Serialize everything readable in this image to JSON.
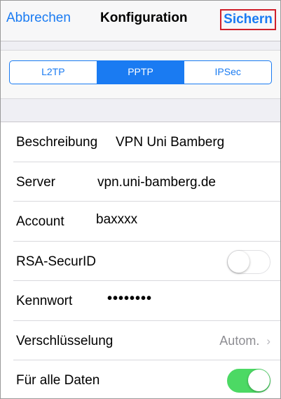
{
  "navbar": {
    "cancel_label": "Abbrechen",
    "title": "Konfiguration",
    "save_label": "Sichern"
  },
  "segments": [
    {
      "label": "L2TP",
      "active": false
    },
    {
      "label": "PPTP",
      "active": true
    },
    {
      "label": "IPSec",
      "active": false
    }
  ],
  "form": {
    "description": {
      "label": "Beschreibung",
      "value": "VPN Uni Bamberg"
    },
    "server": {
      "label": "Server",
      "value": "vpn.uni-bamberg.de"
    },
    "account": {
      "label": "Account",
      "value": "baxxxx"
    },
    "rsa": {
      "label": "RSA-SecurID",
      "toggle": "off"
    },
    "password": {
      "label": "Kennwort",
      "value": "••••••••"
    },
    "encryption": {
      "label": "Verschlüsselung",
      "value": "Autom.",
      "chevron": "›"
    },
    "all_data": {
      "label": "Für alle Daten",
      "toggle": "on"
    }
  },
  "colors": {
    "accent": "#1a7bf2",
    "toggle_on": "#4cd964",
    "highlight_border": "#d0202a",
    "background": "#efeff4"
  }
}
